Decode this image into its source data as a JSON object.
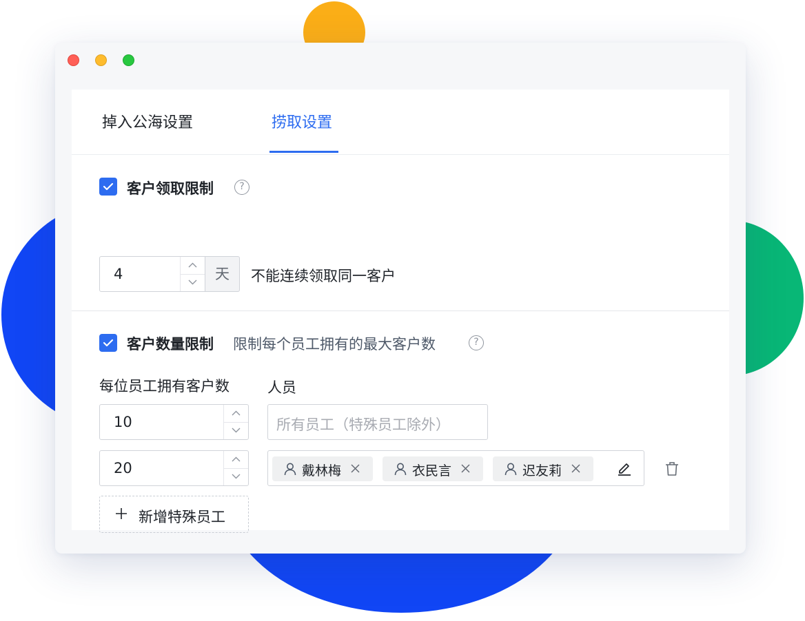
{
  "tabs": [
    {
      "label": "掉入公海设置",
      "active": false
    },
    {
      "label": "捞取设置",
      "active": true
    }
  ],
  "claim_limit": {
    "checked": true,
    "label": "客户领取限制",
    "days_value": "4",
    "days_unit": "天",
    "description": "不能连续领取同一客户"
  },
  "quantity_limit": {
    "checked": true,
    "label": "客户数量限制",
    "description": "限制每个员工拥有的最大客户数",
    "column_count_header": "每位员工拥有客户数",
    "column_people_header": "人员",
    "rows": [
      {
        "count": "10",
        "people_placeholder": "所有员工（特殊员工除外）"
      },
      {
        "count": "20",
        "people": [
          "戴林梅",
          "衣民言",
          "迟友莉"
        ]
      }
    ],
    "add_button_label": "新增特殊员工"
  },
  "colors": {
    "accent": "#2d6cf0",
    "deco_orange": "#FBAE17",
    "deco_blue": "#1146F5",
    "deco_green": "#08B776"
  },
  "icons": [
    "question-circle-icon",
    "chevron-up-icon",
    "chevron-down-icon",
    "user-icon",
    "close-icon",
    "edit-pen-icon",
    "trash-icon",
    "plus-icon",
    "checkmark-icon"
  ]
}
